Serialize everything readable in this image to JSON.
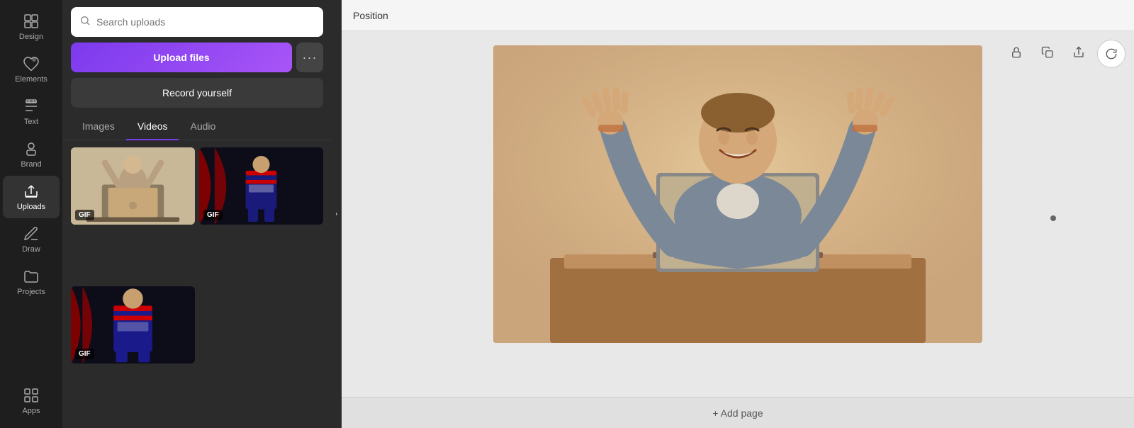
{
  "nav": {
    "items": [
      {
        "id": "design",
        "label": "Design",
        "icon": "grid"
      },
      {
        "id": "elements",
        "label": "Elements",
        "icon": "heart-star"
      },
      {
        "id": "text",
        "label": "Text",
        "icon": "text"
      },
      {
        "id": "brand",
        "label": "Brand",
        "icon": "brand"
      },
      {
        "id": "uploads",
        "label": "Uploads",
        "icon": "upload-cloud",
        "active": true
      },
      {
        "id": "draw",
        "label": "Draw",
        "icon": "draw"
      },
      {
        "id": "projects",
        "label": "Projects",
        "icon": "folder"
      },
      {
        "id": "apps",
        "label": "Apps",
        "icon": "apps"
      }
    ]
  },
  "panel": {
    "search_placeholder": "Search uploads",
    "upload_button_label": "Upload files",
    "more_button_label": "···",
    "record_button_label": "Record yourself",
    "tabs": [
      {
        "id": "images",
        "label": "Images",
        "active": false
      },
      {
        "id": "videos",
        "label": "Videos",
        "active": true
      },
      {
        "id": "audio",
        "label": "Audio",
        "active": false
      }
    ],
    "thumbnails": [
      {
        "id": "thumb1",
        "badge": "GIF",
        "type": "person-laptop"
      },
      {
        "id": "thumb2",
        "badge": "GIF",
        "type": "soccer-player"
      },
      {
        "id": "thumb3",
        "badge": "GIF",
        "type": "soccer-player-solo"
      }
    ]
  },
  "canvas": {
    "toolbar_position_label": "Position",
    "add_page_label": "+ Add page",
    "icon_lock_title": "Lock",
    "icon_duplicate_title": "Duplicate",
    "icon_share_title": "Share"
  }
}
